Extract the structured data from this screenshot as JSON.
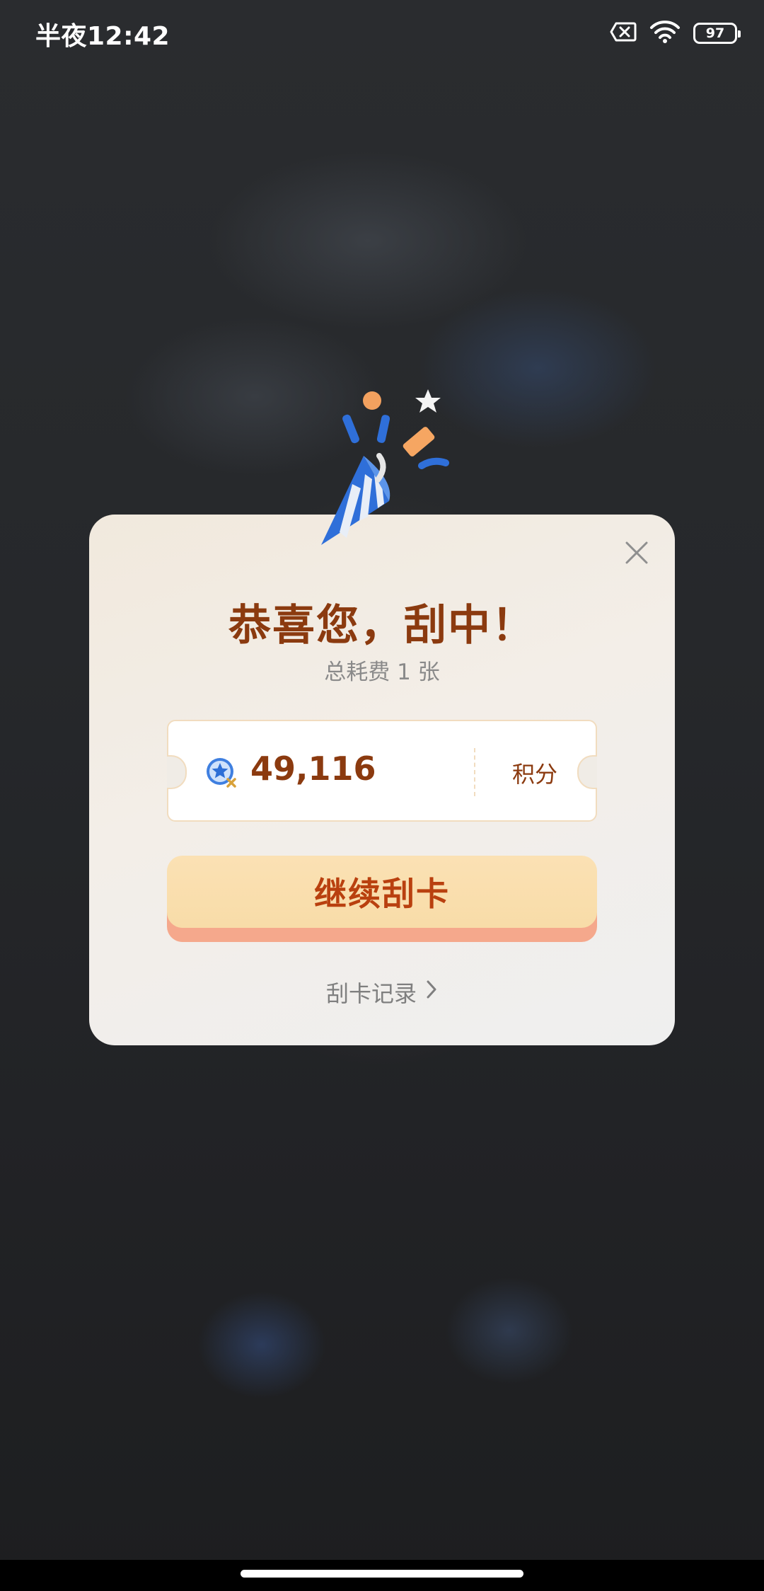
{
  "status_bar": {
    "time": "半夜12:42",
    "battery_level": "97",
    "icons": [
      "sim-off-icon",
      "wifi-icon",
      "battery-icon"
    ]
  },
  "dialog": {
    "title": "恭喜您，刮中！",
    "subtitle": "总耗费 1 张",
    "reward": {
      "icon": "points-coin-icon",
      "value": "49,116",
      "unit": "积分"
    },
    "continue_button_label": "继续刮卡",
    "records_link_label": "刮卡记录",
    "decoration": "party-popper-icon",
    "close_icon": "close-icon"
  },
  "colors": {
    "title": "#8b3a0f",
    "button_face": "#fbe1b4",
    "button_shadow": "#f5a88c",
    "button_text": "#b9400f"
  }
}
